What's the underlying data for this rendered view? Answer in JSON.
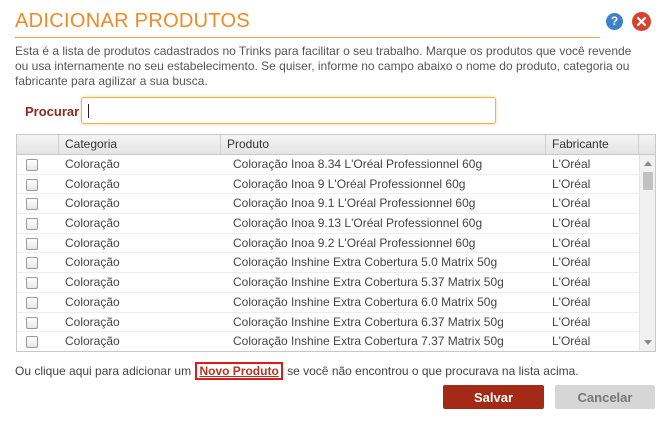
{
  "dialog": {
    "title": "ADICIONAR PRODUTOS",
    "help_icon_glyph": "?",
    "intro": "Esta é a lista de produtos cadastrados no Trinks para facilitar o seu trabalho. Marque os produtos que você revende ou usa internamente no seu estabelecimento. Se quiser, informe no campo abaixo o nome do produto, categoria ou fabricante para agilizar a sua busca."
  },
  "search": {
    "label": "Procurar",
    "value": "",
    "placeholder": ""
  },
  "table": {
    "columns": [
      "Categoria",
      "Produto",
      "Fabricante"
    ],
    "rows": [
      {
        "categoria": "Coloração",
        "produto": "Coloração Inoa 8.34 L'Oréal Professionnel 60g",
        "fabricante": "L'Oréal"
      },
      {
        "categoria": "Coloração",
        "produto": "Coloração Inoa 9 L'Oréal Professionnel 60g",
        "fabricante": "L'Oréal"
      },
      {
        "categoria": "Coloração",
        "produto": "Coloração Inoa 9.1 L'Oréal Professionnel 60g",
        "fabricante": "L'Oréal"
      },
      {
        "categoria": "Coloração",
        "produto": "Coloração Inoa 9.13 L'Oréal Professionnel 60g",
        "fabricante": "L'Oréal"
      },
      {
        "categoria": "Coloração",
        "produto": "Coloração Inoa 9.2 L'Oréal Professionnel 60g",
        "fabricante": "L'Oréal"
      },
      {
        "categoria": "Coloração",
        "produto": "Coloração Inshine Extra Cobertura 5.0 Matrix 50g",
        "fabricante": "L'Oréal"
      },
      {
        "categoria": "Coloração",
        "produto": "Coloração Inshine Extra Cobertura 5.37 Matrix 50g",
        "fabricante": "L'Oréal"
      },
      {
        "categoria": "Coloração",
        "produto": "Coloração Inshine Extra Cobertura 6.0 Matrix 50g",
        "fabricante": "L'Oréal"
      },
      {
        "categoria": "Coloração",
        "produto": "Coloração Inshine Extra Cobertura 6.37 Matrix 50g",
        "fabricante": "L'Oréal"
      },
      {
        "categoria": "Coloração",
        "produto": "Coloração Inshine Extra Cobertura 7.37 Matrix 50g",
        "fabricante": "L'Oréal"
      }
    ]
  },
  "footer": {
    "text_before": "Ou clique aqui para adicionar um",
    "link": "Novo Produto",
    "text_after": "se você não encontrou o que procurava na lista acima."
  },
  "buttons": {
    "save": "Salvar",
    "cancel": "Cancelar"
  },
  "colors": {
    "accent": "#f08a24",
    "save_button": "#a52a16",
    "link_highlight": "#e01a1a"
  }
}
